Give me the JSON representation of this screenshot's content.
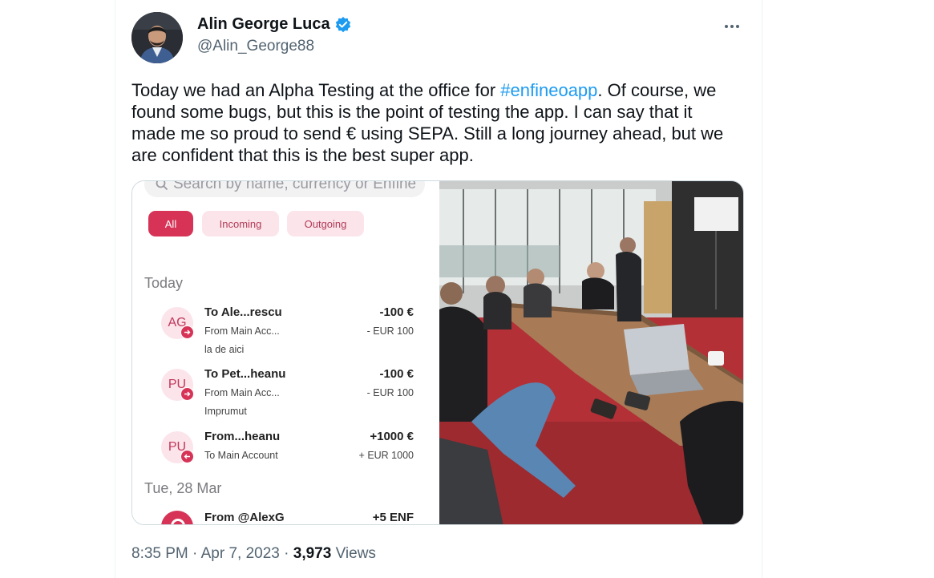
{
  "author": {
    "name": "Alin George Luca",
    "handle": "@Alin_George88",
    "verified": true,
    "avatar_icon": "profile-photo"
  },
  "tweet": {
    "text_before": "Today we had an Alpha Testing at the office for ",
    "hashtag": "#enfineoapp",
    "text_after": ". Of course, we found some bugs, but this is the point of testing the app. I can say that it made me so proud to send € using SEPA. Still a long journey ahead, but we are confident that this is the best super app."
  },
  "app_screenshot": {
    "search_placeholder": "Search by name, currency or Enfine",
    "filters": [
      "All",
      "Incoming",
      "Outgoing"
    ],
    "sections": [
      {
        "label": "Today",
        "transactions": [
          {
            "initials": "AG",
            "title": "To Ale...rescu",
            "sub": "From Main Acc...",
            "note": "la de aici",
            "amount": "-100 €",
            "eur": "- EUR 100",
            "direction": "out"
          },
          {
            "initials": "PU",
            "title": "To Pet...heanu",
            "sub": "From Main Acc...",
            "note": "Imprumut",
            "amount": "-100 €",
            "eur": "- EUR 100",
            "direction": "out"
          },
          {
            "initials": "PU",
            "title": "From...heanu",
            "sub": "To Main Account",
            "note": "",
            "amount": "+1000 €",
            "eur": "+ EUR 1000",
            "direction": "in"
          }
        ]
      },
      {
        "label": "Tue, 28 Mar",
        "transactions": [
          {
            "initials": "",
            "title": "From @AlexG",
            "sub": "",
            "note": "",
            "amount": "+5 ENF",
            "eur": "",
            "direction": "in"
          }
        ]
      }
    ],
    "accent_color": "#d63357"
  },
  "meta": {
    "time": "8:35 PM",
    "date": "Apr 7, 2023",
    "views_count": "3,973",
    "views_label": "Views"
  },
  "colors": {
    "link": "#1d9bf0",
    "verified": "#1d9bf0",
    "secondary_text": "#536471"
  }
}
